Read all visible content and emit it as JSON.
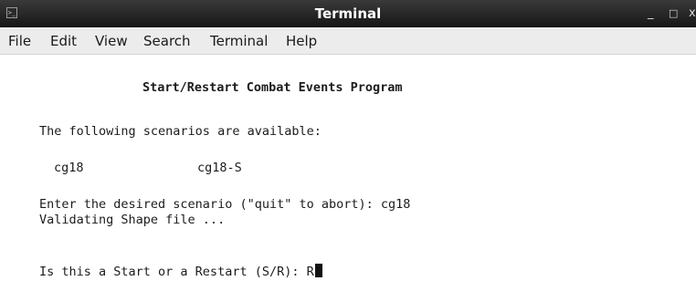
{
  "window": {
    "title": "Terminal",
    "controls": {
      "minimize": "_",
      "maximize": "□",
      "close": "x"
    }
  },
  "menubar": {
    "items": [
      {
        "label": "File"
      },
      {
        "label": "Edit"
      },
      {
        "label": "View"
      },
      {
        "label": "Search"
      },
      {
        "label": "Terminal"
      },
      {
        "label": "Help"
      }
    ]
  },
  "terminal": {
    "heading": "Start/Restart Combat Events Program",
    "available_text": "The following scenarios are available:",
    "scenarios": [
      "cg18",
      "cg18-S"
    ],
    "enter_prompt": "Enter the desired scenario (\"quit\" to abort): cg18",
    "validating_text": "Validating Shape file ...",
    "start_restart_prompt": "Is this a Start or a Restart (S/R): R"
  },
  "colors": {
    "titlebar": "#1e1e1e",
    "menubar": "#ececec",
    "background": "#ffffff",
    "text": "#1c1c1c"
  }
}
